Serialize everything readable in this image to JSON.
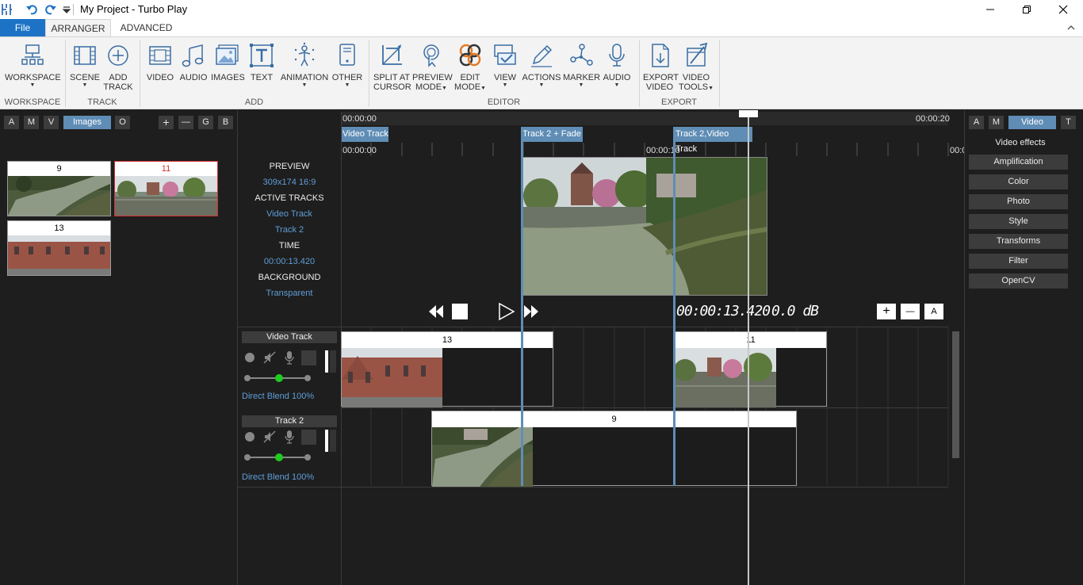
{
  "window": {
    "title": "My Project - Turbo Play"
  },
  "tabs": [
    {
      "label": "File"
    },
    {
      "label": "ARRANGER"
    },
    {
      "label": "ADVANCED"
    }
  ],
  "ribbon": {
    "buttons": [
      {
        "label": "WORKSPACE",
        "icon": "workspace-icon",
        "dropdown": true
      },
      {
        "label": "SCENE",
        "icon": "scene-icon",
        "dropdown": true
      },
      {
        "label": "ADD",
        "label2": "TRACK",
        "icon": "add-track-icon"
      },
      {
        "label": "VIDEO",
        "icon": "video-icon"
      },
      {
        "label": "AUDIO",
        "icon": "audio-icon"
      },
      {
        "label": "IMAGES",
        "icon": "images-icon"
      },
      {
        "label": "TEXT",
        "icon": "text-icon"
      },
      {
        "label": "ANIMATION",
        "icon": "animation-icon",
        "dropdown": true
      },
      {
        "label": "OTHER",
        "icon": "other-icon",
        "dropdown": true
      },
      {
        "label": "SPLIT AT",
        "label2": "CURSOR",
        "icon": "split-icon"
      },
      {
        "label": "PREVIEW",
        "label2": "MODE",
        "icon": "preview-mode-icon",
        "dropdown": true
      },
      {
        "label": "EDIT",
        "label2": "MODE",
        "icon": "edit-mode-icon",
        "dropdown": true
      },
      {
        "label": "VIEW",
        "icon": "view-icon",
        "dropdown": true
      },
      {
        "label": "ACTIONS",
        "icon": "actions-icon",
        "dropdown": true
      },
      {
        "label": "MARKER",
        "icon": "marker-icon",
        "dropdown": true
      },
      {
        "label": "AUDIO",
        "icon": "microphone-icon",
        "dropdown": true
      },
      {
        "label": "EXPORT",
        "label2": "VIDEO",
        "icon": "export-video-icon"
      },
      {
        "label": "VIDEO",
        "label2": "TOOLS",
        "icon": "video-tools-icon",
        "dropdown": true
      }
    ],
    "groups": [
      {
        "label": "WORKSPACE"
      },
      {
        "label": "TRACK"
      },
      {
        "label": "ADD"
      },
      {
        "label": "EDITOR"
      },
      {
        "label": "EXPORT"
      }
    ]
  },
  "left_panel": {
    "filters": [
      "A",
      "M",
      "V",
      "Images",
      "O"
    ],
    "active_filter": "Images",
    "tools": [
      "+",
      "—",
      "G",
      "B"
    ],
    "items": [
      {
        "label": "9"
      },
      {
        "label": "11",
        "selected": true
      },
      {
        "label": "13"
      }
    ]
  },
  "timeline": {
    "ruler_start": "00:00:00",
    "ruler_end": "00:00:20",
    "clip_headers": [
      "Video Track",
      "Track 2 + Fade",
      "Track 2,Video Track"
    ],
    "tick_labels": [
      "00:00:00",
      "00:00:10",
      "00:0"
    ]
  },
  "preview_info": {
    "preview_label": "PREVIEW",
    "preview_value": "309x174 16:9",
    "active_tracks_label": "ACTIVE TRACKS",
    "active_tracks": [
      "Video Track",
      "Track 2"
    ],
    "time_label": "TIME",
    "time_value": "00:00:13.420",
    "background_label": "BACKGROUND",
    "background_value": "Transparent"
  },
  "playback": {
    "timecode": "00:00:13.420",
    "volume": "0.0 dB",
    "zoom_buttons": [
      "+",
      "—",
      "A"
    ]
  },
  "tracks": [
    {
      "name": "Video Track",
      "blend": "Direct Blend 100%",
      "clips": [
        {
          "label": "13"
        },
        {
          "label": "11"
        }
      ]
    },
    {
      "name": "Track 2",
      "blend": "Direct Blend 100%",
      "clips": [
        {
          "label": "9"
        }
      ]
    }
  ],
  "right_panel": {
    "tabs": [
      "A",
      "M",
      "Video",
      "T"
    ],
    "active_tab": "Video",
    "title": "Video effects",
    "effects": [
      "Amplification",
      "Color",
      "Photo",
      "Style",
      "Transforms",
      "Filter",
      "OpenCV"
    ]
  },
  "colors": {
    "accent": "#5f8db5",
    "file_tab": "#1c73c6",
    "selection_red": "#d43030",
    "info_blue": "#5f9ed8"
  }
}
